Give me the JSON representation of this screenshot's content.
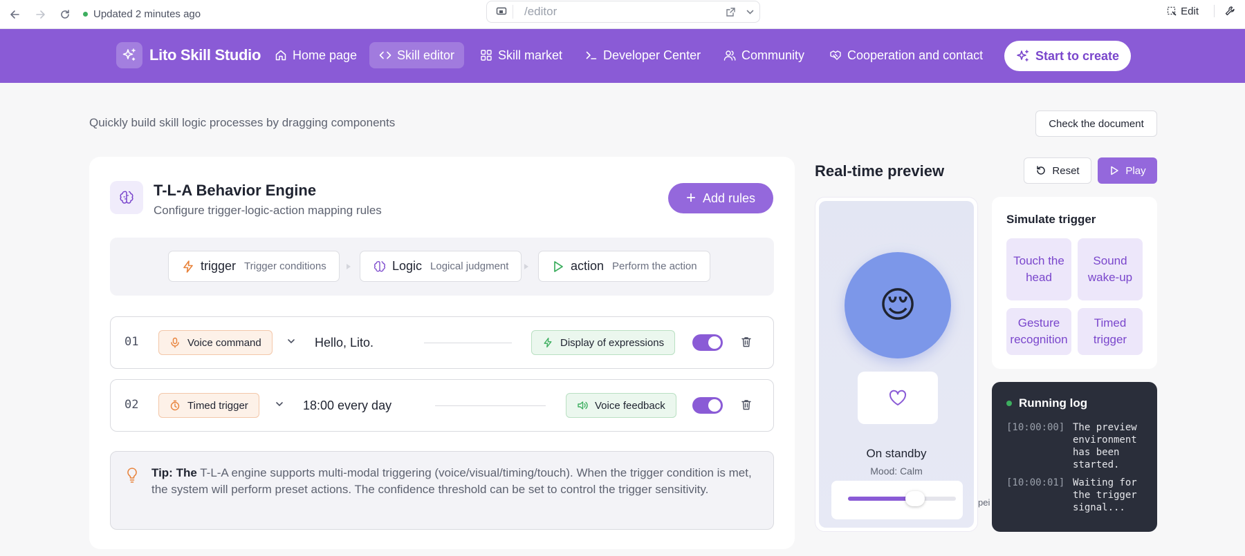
{
  "browser": {
    "updated_text": "Updated 2 minutes ago",
    "url": "/editor",
    "edit_label": "Edit"
  },
  "nav": {
    "brand": "Lito Skill Studio",
    "items": [
      {
        "label": "Home page",
        "icon": "home-icon"
      },
      {
        "label": "Skill editor",
        "icon": "code-icon",
        "active": true
      },
      {
        "label": "Skill market",
        "icon": "grid-icon"
      },
      {
        "label": "Developer Center",
        "icon": "terminal-icon"
      },
      {
        "label": "Community",
        "icon": "users-icon"
      },
      {
        "label": "Cooperation and contact",
        "icon": "handshake-icon"
      }
    ],
    "cta": "Start to create"
  },
  "page": {
    "subtitle": "Quickly build skill logic processes by dragging components",
    "doc_button": "Check the document"
  },
  "engine": {
    "title": "T-L-A Behavior Engine",
    "description": "Configure trigger-logic-action mapping rules",
    "add_rules": "Add rules",
    "flow": [
      {
        "label": "trigger",
        "sub": "Trigger conditions",
        "icon": "bolt-icon"
      },
      {
        "label": "Logic",
        "sub": "Logical judgment",
        "icon": "brain-icon"
      },
      {
        "label": "action",
        "sub": "Perform the action",
        "icon": "play-icon"
      }
    ],
    "rules": [
      {
        "num": "01",
        "trigger": "Voice command",
        "trigger_icon": "mic-icon",
        "value": "Hello, Lito.",
        "action": "Display of expressions",
        "action_icon": "bolt-icon",
        "enabled": true
      },
      {
        "num": "02",
        "trigger": "Timed trigger",
        "trigger_icon": "timer-icon",
        "value": "18:00 every day",
        "action": "Voice feedback",
        "action_icon": "speaker-icon",
        "enabled": true
      }
    ],
    "tip_label": "Tip: The",
    "tip_text": " T-L-A engine supports multi-modal triggering (voice/visual/timing/touch). When the trigger condition is met, the system will perform preset actions. The confidence threshold can be set to control the trigger sensitivity."
  },
  "preview": {
    "title": "Real-time preview",
    "reset": "Reset",
    "play": "Play",
    "face_emoji": "😌",
    "status": "On standby",
    "mood": "Mood: Calm",
    "slider_overflow": "pei",
    "slider_level": 0.62
  },
  "simulate": {
    "title": "Simulate trigger",
    "buttons": [
      "Touch the head",
      "Sound wake-up",
      "Gesture recognition",
      "Timed trigger"
    ]
  },
  "log": {
    "title": "Running log",
    "entries": [
      {
        "time": "[10:00:00]",
        "message": "The preview environment has been started."
      },
      {
        "time": "[10:00:01]",
        "message": "Waiting for the trigger signal..."
      }
    ]
  },
  "colors": {
    "brand_purple": "#8a5bd6",
    "accent_orange": "#e8823a",
    "accent_green": "#3dae5f",
    "log_bg": "#2a2e3a"
  }
}
